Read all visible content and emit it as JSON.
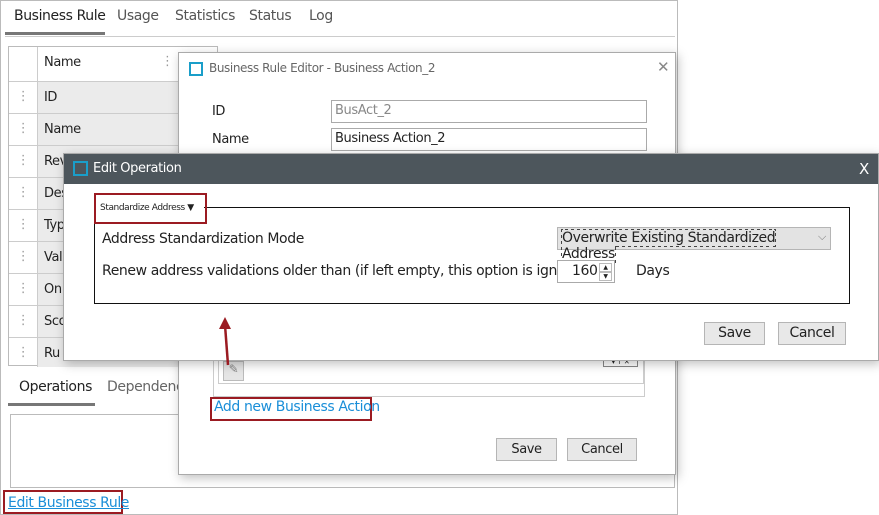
{
  "main_tabs": [
    {
      "label": "Business Rule"
    },
    {
      "label": "Usage"
    },
    {
      "label": "Statistics"
    },
    {
      "label": "Status"
    },
    {
      "label": "Log"
    }
  ],
  "table": {
    "header": "Name",
    "rows": [
      "ID",
      "Name",
      "Rev",
      "Des",
      "Typ",
      "Val",
      "On",
      "Sco",
      "Ru"
    ]
  },
  "bottom_tabs": [
    {
      "label": "Operations"
    },
    {
      "label": "Dependenci"
    }
  ],
  "edit_business_rule_link": "Edit Business Rule",
  "rule_editor": {
    "title": "Business Rule Editor - Business Action_2",
    "id_label": "ID",
    "id_value": "BusAct_2",
    "name_label": "Name",
    "name_value": "Business Action_2",
    "add_link": "Add new Business Action",
    "save": "Save",
    "cancel": "Cancel"
  },
  "edit_operation": {
    "title": "Edit Operation",
    "close": "X",
    "legend": "Standardize Address",
    "mode_label": "Address Standardization Mode",
    "mode_value": "Overwrite Existing Standardized Address",
    "renew_label": "Renew address validations older than (if left empty, this option is ignored)",
    "renew_value": "160",
    "renew_unit": "Days",
    "save": "Save",
    "cancel": "Cancel"
  },
  "colors": {
    "titlebar": "#4d565c",
    "accent": "#1a9ec9",
    "highlight": "#9b1b22",
    "link": "#1a8ed8"
  }
}
